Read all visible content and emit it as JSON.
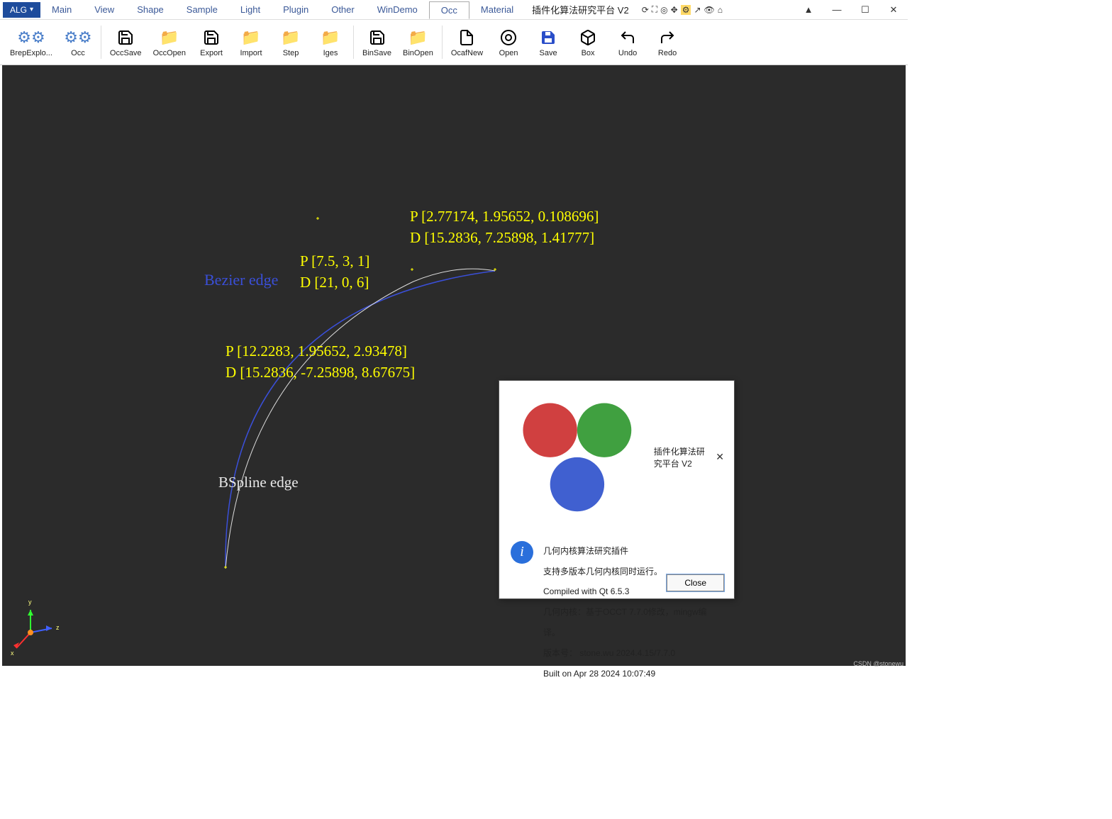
{
  "app": {
    "alg_label": "ALG",
    "title": "插件化算法研究平台 V2"
  },
  "menus": [
    "Main",
    "View",
    "Shape",
    "Sample",
    "Light",
    "Plugin",
    "Other",
    "WinDemo",
    "Occ",
    "Material"
  ],
  "menu_active_index": 8,
  "toolbar": [
    {
      "label": "BrepExplo...",
      "icon": "gear"
    },
    {
      "label": "Occ",
      "icon": "gear"
    },
    {
      "sep": true
    },
    {
      "label": "OccSave",
      "icon": "save"
    },
    {
      "label": "OccOpen",
      "icon": "folder"
    },
    {
      "label": "Export",
      "icon": "save"
    },
    {
      "label": "Import",
      "icon": "folder"
    },
    {
      "label": "Step",
      "icon": "folder"
    },
    {
      "label": "Iges",
      "icon": "folder"
    },
    {
      "sep": true
    },
    {
      "label": "BinSave",
      "icon": "save"
    },
    {
      "label": "BinOpen",
      "icon": "folder"
    },
    {
      "sep": true
    },
    {
      "label": "OcafNew",
      "icon": "new"
    },
    {
      "label": "Open",
      "icon": "open"
    },
    {
      "label": "Save",
      "icon": "disk"
    },
    {
      "label": "Box",
      "icon": "box"
    },
    {
      "label": "Undo",
      "icon": "undo"
    },
    {
      "label": "Redo",
      "icon": "redo"
    }
  ],
  "viewport": {
    "bezier_label": "Bezier edge",
    "bspline_label": "BSpline edge",
    "annotation1": {
      "P": "P [2.77174, 1.95652, 0.108696]",
      "D": "D [15.2836, 7.25898, 1.41777]"
    },
    "annotation2": {
      "P": "P [7.5, 3, 1]",
      "D": "D [21, 0, 6]"
    },
    "annotation3": {
      "P": "P [12.2283, 1.95652, 2.93478]",
      "D": "D [15.2836, -7.25898, 8.67675]"
    },
    "axis": {
      "x": "x",
      "y": "y",
      "z": "z"
    }
  },
  "dialog": {
    "title": "插件化算法研究平台 V2",
    "lines": [
      "几何内核算法研究插件",
      "支持多版本几何内核同时运行。",
      "Compiled with Qt 6.5.3",
      "几何内核：基于OCCT 7.7.0修改，mingw编译。",
      "版本号： stone.wu 2024.4.15/7.7.0",
      "Built on Apr 28 2024 10:07:49"
    ],
    "close": "Close"
  },
  "watermark": "CSDN @stonewu"
}
